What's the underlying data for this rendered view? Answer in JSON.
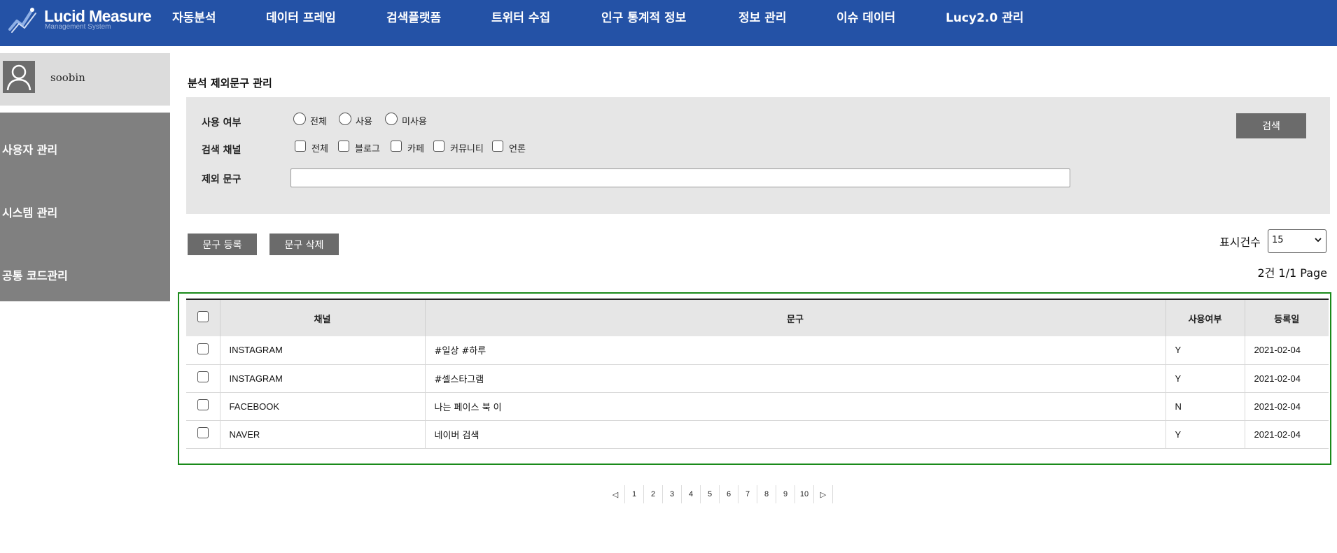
{
  "header": {
    "logo_title": "Lucid Measure",
    "logo_subtitle": "Management System",
    "nav": [
      "자동분석",
      "데이터 프레임",
      "검색플랫폼",
      "트위터 수집",
      "인구 통계적 정보",
      "정보 관리",
      "이슈 데이터",
      "Lucy2.0 관리"
    ]
  },
  "sidebar": {
    "username": "soobin",
    "items": [
      "사용자 관리",
      "시스템 관리",
      "공통 코드관리"
    ]
  },
  "page": {
    "title": "분석 제외문구 관리"
  },
  "filters": {
    "use_label": "사용 여부",
    "use_options": [
      "전체",
      "사용",
      "미사용"
    ],
    "channel_label": "검색 채널",
    "channel_options": [
      "전체",
      "블로그",
      "카페",
      "커뮤니티",
      "언론"
    ],
    "phrase_label": "제외 문구",
    "phrase_value": "",
    "search_button": "검색"
  },
  "actions": {
    "register_button": "문구 등록",
    "delete_button": "문구 삭제",
    "page_size_label": "표시건수",
    "page_size_value": "15",
    "count_text": "2건 1/1 Page"
  },
  "table": {
    "headers": [
      "채널",
      "문구",
      "사용여부",
      "등록일"
    ],
    "rows": [
      {
        "channel": "INSTAGRAM",
        "phrase": "#일상 #하루",
        "use": "Y",
        "date": "2021-02-04"
      },
      {
        "channel": "INSTAGRAM",
        "phrase": "#셀스타그램",
        "use": "Y",
        "date": "2021-02-04"
      },
      {
        "channel": "FACEBOOK",
        "phrase": "나는 페이스 북 이",
        "use": "N",
        "date": "2021-02-04"
      },
      {
        "channel": "NAVER",
        "phrase": "네이버 검색",
        "use": "Y",
        "date": "2021-02-04"
      }
    ]
  },
  "pagination": {
    "prev": "◁",
    "pages": [
      "1",
      "2",
      "3",
      "4",
      "5",
      "6",
      "7",
      "8",
      "9",
      "10"
    ],
    "next": "▷"
  },
  "colors": {
    "nav_bg": "#2452a6",
    "sidebar_bg": "#808080",
    "button_bg": "#6b6b6b",
    "table_frame": "#1a8a1a"
  }
}
